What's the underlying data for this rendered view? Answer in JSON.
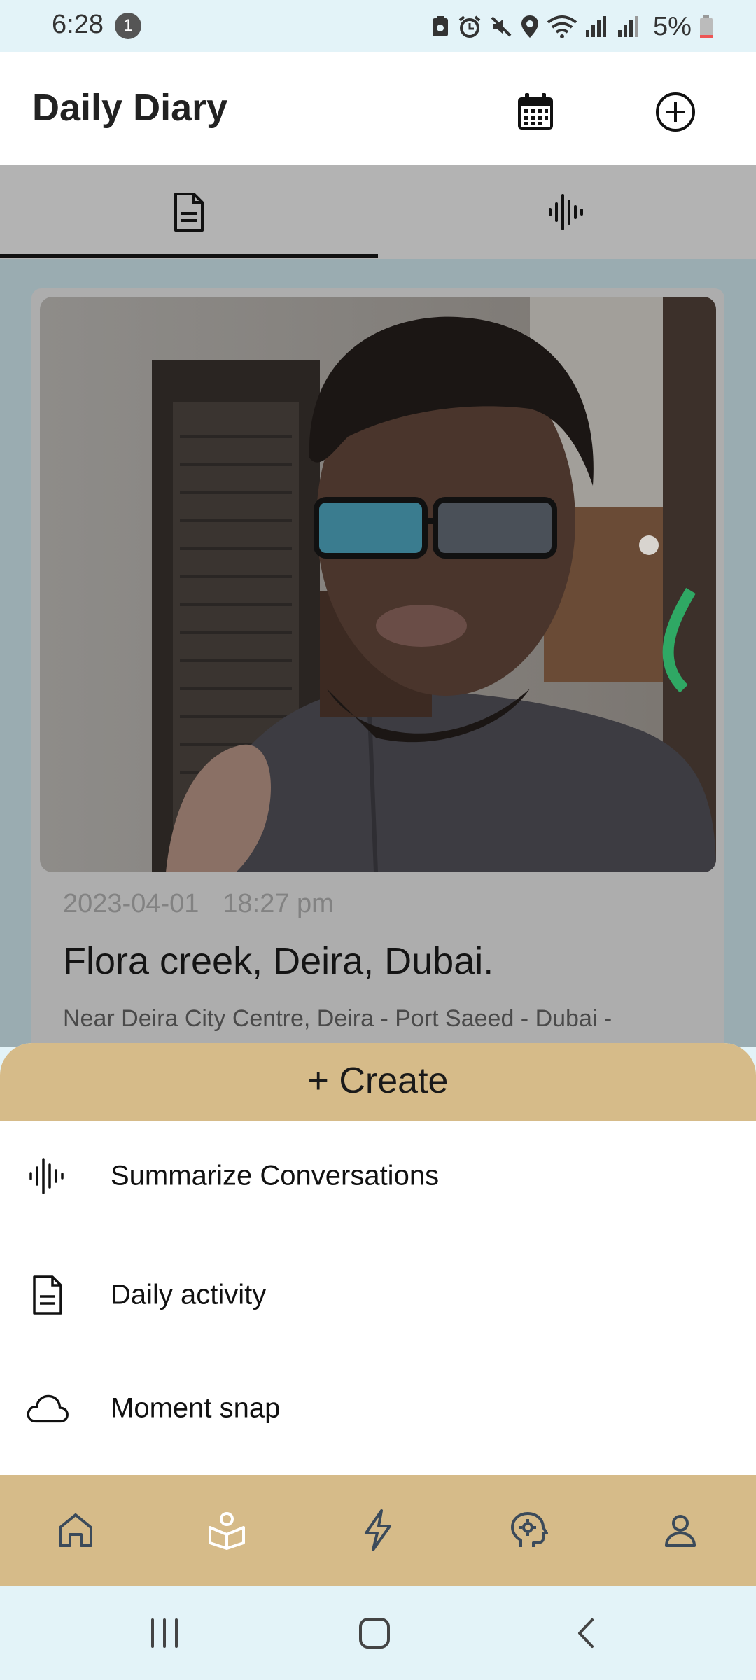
{
  "status_bar": {
    "time": "6:28",
    "notification_count": "1",
    "battery": "5%"
  },
  "app_bar": {
    "title": "Daily Diary",
    "icons": [
      "calendar-icon",
      "add-circle-icon"
    ]
  },
  "tabs": [
    {
      "icon": "document-icon",
      "selected": true
    },
    {
      "icon": "waveform-icon",
      "selected": false
    }
  ],
  "entry": {
    "date": "2023-04-01",
    "time": "18:27 pm",
    "title": "Flora creek, Deira, Dubai.",
    "address": "Near Deira City Centre, Deira - Port Saeed - Dubai -"
  },
  "create_sheet": {
    "title": "+ Create",
    "items": [
      {
        "label": "Summarize Conversations",
        "icon": "waveform-icon"
      },
      {
        "label": "Daily activity",
        "icon": "document-icon"
      },
      {
        "label": "Moment snap",
        "icon": "cloud-icon"
      }
    ]
  },
  "bottom_nav": [
    "home-icon",
    "reader-icon",
    "bolt-icon",
    "brain-gear-icon",
    "profile-icon"
  ],
  "colors": {
    "accent": "#d6bb89",
    "status_background": "#e3f3f8",
    "scrim_content": "#9aacb1"
  }
}
